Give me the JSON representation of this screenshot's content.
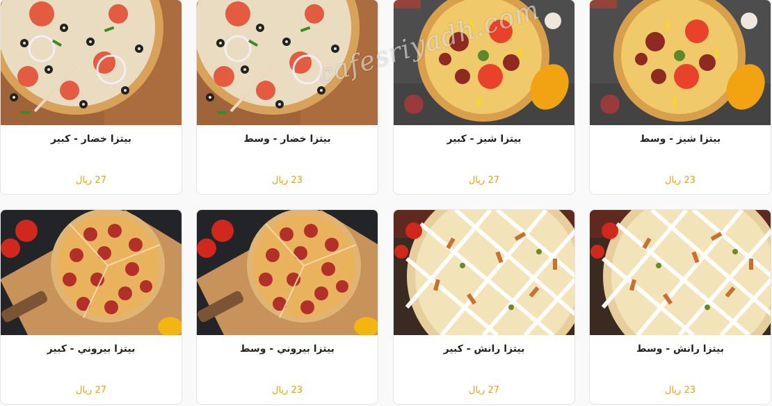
{
  "products": [
    {
      "name": "بيتزا خضار - كبير",
      "price": "27 ريال",
      "photo": "veggie-pizza-photo"
    },
    {
      "name": "بيتزا خضار - وسط",
      "price": "23 ريال",
      "photo": "veggie-pizza-photo"
    },
    {
      "name": "بيتزا شيز - كبير",
      "price": "27 ريال",
      "photo": "cheese-pizza-photo"
    },
    {
      "name": "بيتزا شيز - وسط",
      "price": "23 ريال",
      "photo": "cheese-pizza-photo"
    },
    {
      "name": "بيتزا بيروني - كبير",
      "price": "27 ريال",
      "photo": "pepperoni-pizza-photo"
    },
    {
      "name": "بيتزا بيروني - وسط",
      "price": "23 ريال",
      "photo": "pepperoni-pizza-photo"
    },
    {
      "name": "بيتزا رانش - كبير",
      "price": "27 ريال",
      "photo": "ranch-pizza-photo"
    },
    {
      "name": "بيتزا رانش - وسط",
      "price": "23 ريال",
      "photo": "ranch-pizza-photo"
    }
  ],
  "watermark": "cafesriyadh.com",
  "colors": {
    "price": "#f0a000",
    "card_border": "#e4e4e4"
  }
}
